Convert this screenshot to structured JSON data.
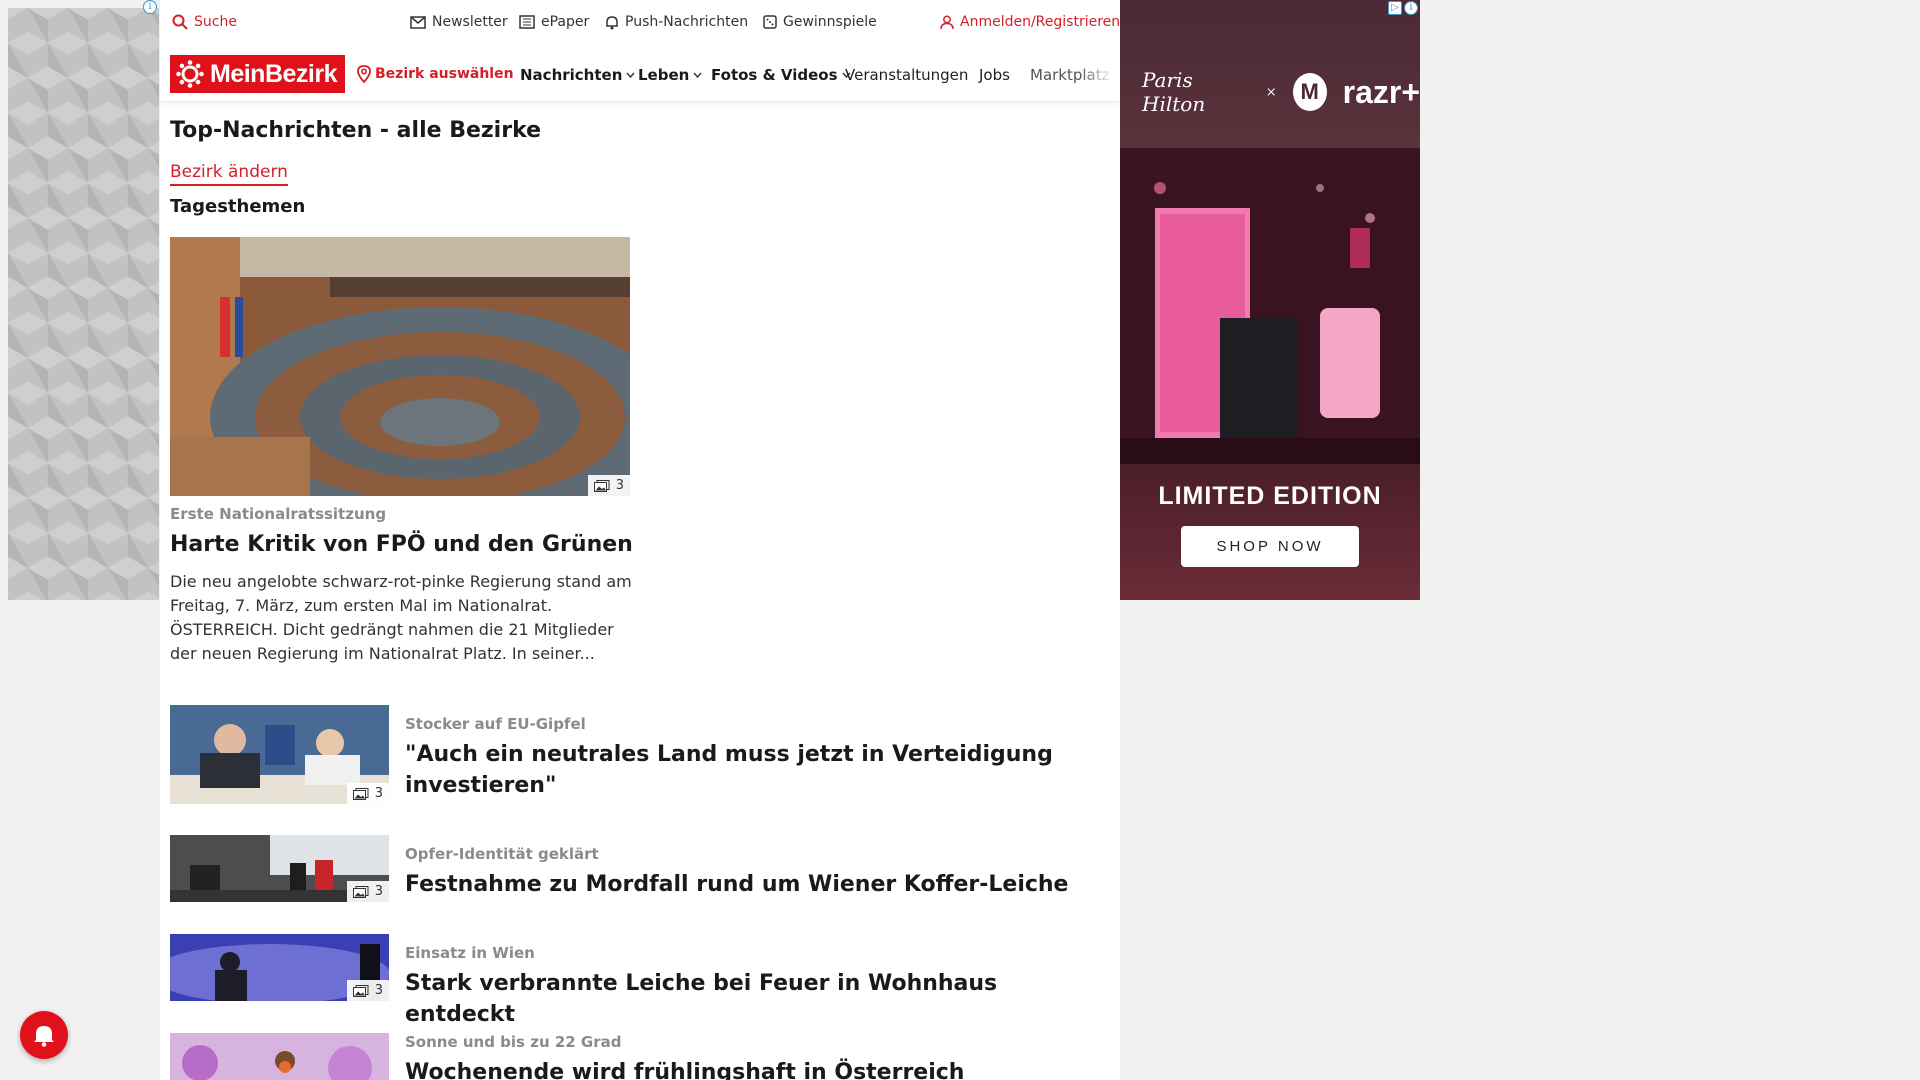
{
  "topbar": {
    "search_label": "Suche",
    "newsletter_label": "Newsletter",
    "epaper_label": "ePaper",
    "push_label": "Push-Nachrichten",
    "gewinnspiele_label": "Gewinnspiele",
    "login_label": "Anmelden/Registrieren"
  },
  "navbar": {
    "logo_text": "MeinBezirk",
    "select_district": "Bezirk auswählen",
    "items": [
      {
        "label": "Nachrichten"
      },
      {
        "label": "Leben"
      },
      {
        "label": "Fotos & Videos"
      },
      {
        "label": "Veranstaltungen"
      },
      {
        "label": "Jobs"
      },
      {
        "label": "Marktplatz"
      }
    ]
  },
  "page": {
    "title": "Top-Nachrichten - alle Bezirke",
    "change_district": "Bezirk ändern",
    "section_title": "Tagesthemen"
  },
  "hero": {
    "image_count": "3",
    "kicker": "Erste Nationalratssitzung",
    "headline": "Harte Kritik von FPÖ und den Grünen",
    "teaser": "Die neu angelobte schwarz-rot-pinke Regierung stand am Freitag, 7. März, zum ersten Mal im Nationalrat. ÖSTERREICH. Dicht gedrängt nahmen die 21 Mitglieder der neuen Regierung im Nationalrat Platz. In seiner..."
  },
  "articles": [
    {
      "kicker": "Stocker auf EU-Gipfel",
      "headline": "\"Auch ein neutrales Land muss jetzt in Verteidigung investieren\"",
      "image_count": "3"
    },
    {
      "kicker": "Opfer-Identität geklärt",
      "headline": "Festnahme zu Mordfall rund um Wiener Koffer-Leiche",
      "image_count": "3"
    },
    {
      "kicker": "Einsatz in Wien",
      "headline": "Stark verbrannte Leiche bei Feuer in Wohnhaus entdeckt",
      "image_count": "3"
    },
    {
      "kicker": "Sonne und bis zu 22 Grad",
      "headline": "Wochenende wird frühlingshaft in Österreich"
    }
  ],
  "ad": {
    "brand_script": "Paris Hilton",
    "brand_x": "×",
    "brand_logo": "M",
    "brand_name": "razr+",
    "limited": "LIMITED EDITION",
    "shop": "SHOP NOW"
  },
  "colors": {
    "brand_red": "#e0111a",
    "link_red": "#d51f26"
  }
}
